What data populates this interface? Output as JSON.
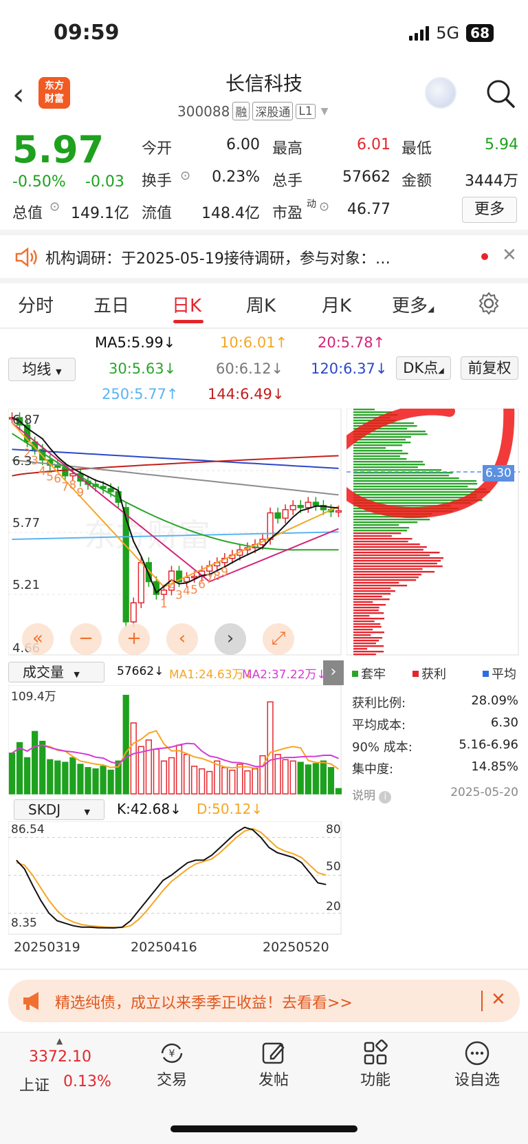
{
  "status": {
    "time": "09:59",
    "network": "5G",
    "battery": "68"
  },
  "header": {
    "logo_line1": "东方",
    "logo_line2": "财富",
    "title": "长信科技",
    "code": "300088",
    "tags": [
      "融",
      "深股通",
      "L1"
    ]
  },
  "quote": {
    "price": "5.97",
    "change_pct": "-0.50%",
    "change": "-0.03",
    "open_label": "今开",
    "open": "6.00",
    "high_label": "最高",
    "high": "6.01",
    "low_label": "最低",
    "low": "5.94",
    "turnover_label": "换手",
    "turnover": "0.23%",
    "volume_label": "总手",
    "volume": "57662",
    "amount_label": "金额",
    "amount": "3444万",
    "mktcap_label": "总值",
    "mktcap": "149.1亿",
    "float_label": "流值",
    "float": "148.4亿",
    "pe_label": "市盈",
    "pe_sup": "动",
    "pe": "46.77",
    "more": "更多"
  },
  "news": {
    "text": "机构调研：于2025-05-19接待调研，参与对象：…"
  },
  "tabs": [
    "分时",
    "五日",
    "日K",
    "周K",
    "月K",
    "更多"
  ],
  "ma": {
    "selector": "均线",
    "ma5": "MA5:5.99↓",
    "ma10": "10:6.01↑",
    "ma20": "20:5.78↑",
    "ma30": "30:5.63↓",
    "ma60": "60:6.12↓",
    "ma120": "120:6.37↓",
    "ma250": "250:5.77↑",
    "ma144": "144:6.49↓",
    "dk": "DK点",
    "fq": "前复权"
  },
  "kline": {
    "y_labels": [
      "6.87",
      "6.3",
      "5.77",
      "5.21",
      "4.66"
    ],
    "cost_price": "6.30",
    "colors": {
      "up": "#e3262d",
      "down": "#1ea11e",
      "ma5": "#111111",
      "ma10": "#f5a623",
      "ma20": "#d4237a",
      "ma30": "#2aa52a",
      "ma60": "#8c8c8c",
      "ma120": "#2b48c8",
      "ma250": "#5ab4f0",
      "ma144": "#c0201c"
    },
    "td_labels": [
      "2",
      "3",
      "4",
      "5",
      "6",
      "7",
      "8",
      "9",
      "1",
      "2",
      "3",
      "4",
      "5",
      "6",
      "7",
      "8",
      "9"
    ]
  },
  "chip": {
    "legend": [
      "套牢",
      "获利",
      "平均"
    ],
    "stats": [
      {
        "label": "获利比例:",
        "value": "28.09%"
      },
      {
        "label": "平均成本:",
        "value": "6.30"
      },
      {
        "label": "90% 成本:",
        "value": "5.16-6.96"
      },
      {
        "label": "集中度:",
        "value": "14.85%"
      }
    ],
    "note_label": "说明",
    "date": "2025-05-20"
  },
  "volume_panel": {
    "selector": "成交量",
    "vol": "57662↓",
    "ma1": "MA1:24.63万↓",
    "ma2": "MA2:37.22万↓",
    "max_label": "109.4万"
  },
  "skdj": {
    "selector": "SKDJ",
    "k": "K:42.68↓",
    "d": "D:50.12↓",
    "max_label": "86.54",
    "min_label": "8.35",
    "levels": [
      "80",
      "50",
      "20"
    ]
  },
  "x_dates": [
    "20250319",
    "20250416",
    "20250520"
  ],
  "ad": {
    "text": "精选纯债，成立以来季季正收益！去看看>>"
  },
  "bottom": {
    "index_value": "3372.10",
    "index_name": "上证",
    "index_pct": "0.13%",
    "items": [
      "交易",
      "发帖",
      "功能",
      "设自选"
    ]
  }
}
